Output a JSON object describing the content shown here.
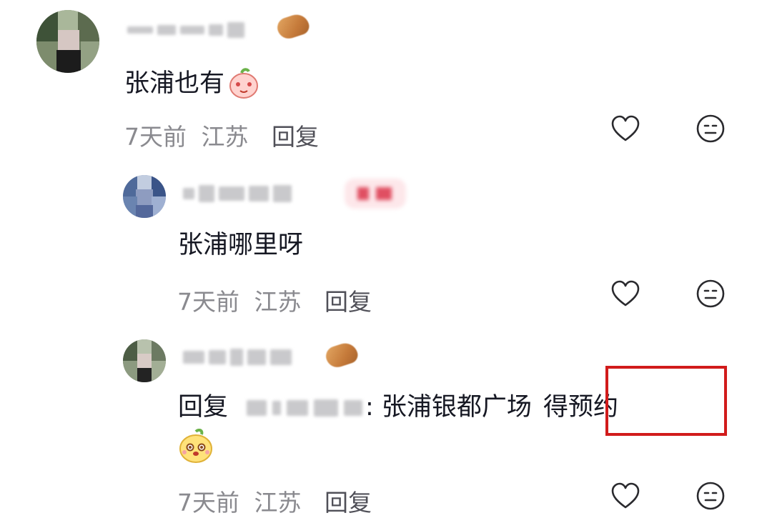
{
  "comments": [
    {
      "text": "张浦也有",
      "time": "7天前",
      "location": "江苏",
      "reply_label": "回复"
    },
    {
      "text": "张浦哪里呀",
      "time": "7天前",
      "location": "江苏",
      "reply_label": "回复"
    },
    {
      "reply_prefix": "回复",
      "text_main": ": 张浦银都广场",
      "text_highlight": "得预约",
      "time": "7天前",
      "location": "江苏",
      "reply_label": "回复"
    }
  ],
  "icons": {
    "like": "heart-outline-icon",
    "dislike": "meh-face-icon"
  },
  "colors": {
    "highlight_border": "#d11b1b",
    "meta_text": "#8a8a8f",
    "icon_stroke": "#2a2a2e"
  }
}
